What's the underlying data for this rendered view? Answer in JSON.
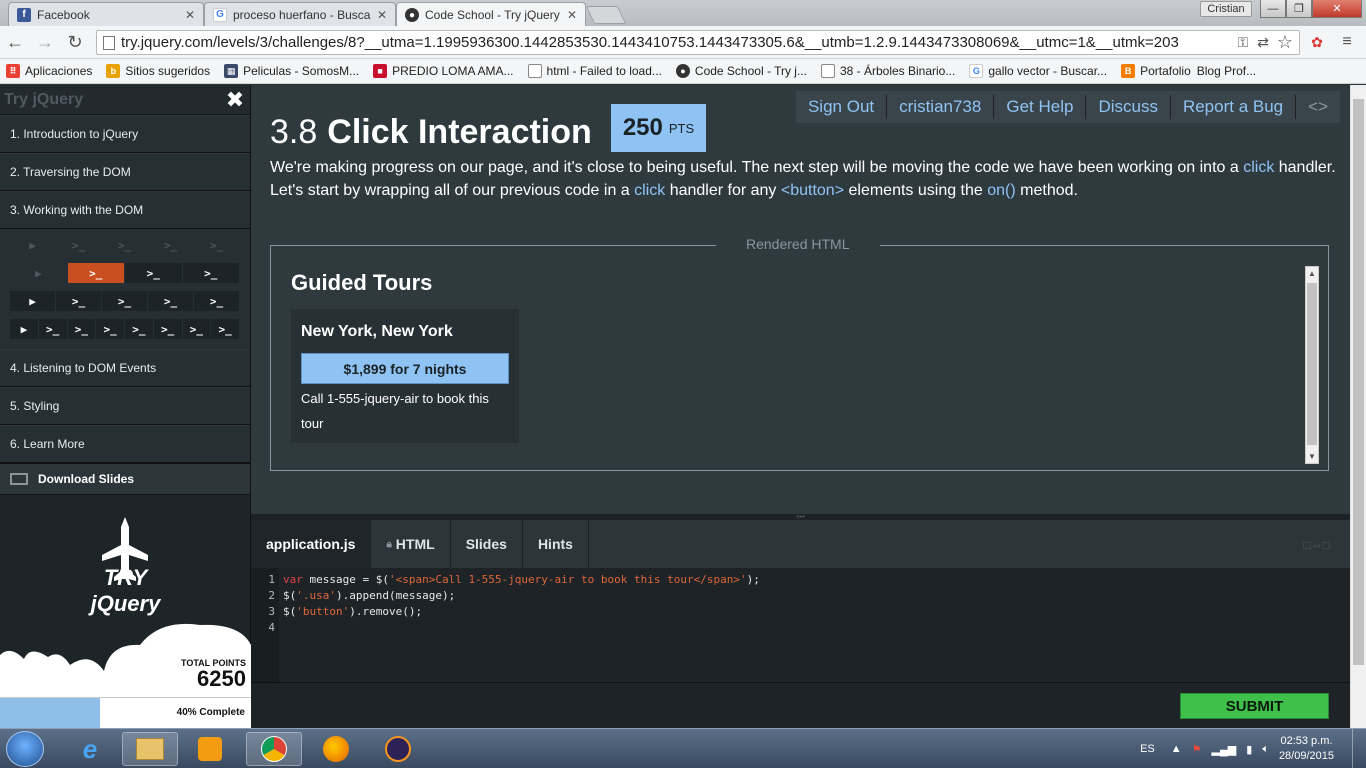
{
  "browser": {
    "tabs": [
      {
        "title": "Facebook",
        "icon": "facebook-icon",
        "color": "#3b5998"
      },
      {
        "title": "proceso huerfano - Buscar",
        "icon": "google-icon",
        "color": "#4285f4"
      },
      {
        "title": "Code School - Try jQuery",
        "icon": "codeschool-icon",
        "color": "#333333"
      }
    ],
    "user": "Cristian",
    "url": "try.jquery.com/levels/3/challenges/8?__utma=1.1995936300.1442853530.1443410753.1443473305.6&__utmb=1.2.9.1443473308069&__utmc=1&__utmk=203",
    "bookmarks": [
      {
        "label": "Aplicaciones",
        "icon": "apps-icon",
        "color": "#e94235"
      },
      {
        "label": "Sitios sugeridos",
        "icon": "bookmark-icon",
        "color": "#e8a200"
      },
      {
        "label": "Peliculas - SomosM...",
        "icon": "film-icon",
        "color": "#3a4a6a"
      },
      {
        "label": "PREDIO LOMA AMA...",
        "icon": "site-icon",
        "color": "#c8102e"
      },
      {
        "label": "html - Failed to load...",
        "icon": "page-icon",
        "color": "#888888"
      },
      {
        "label": "Code School - Try j...",
        "icon": "codeschool-icon",
        "color": "#333333"
      },
      {
        "label": "38 - Árboles Binario...",
        "icon": "page-icon",
        "color": "#888888"
      },
      {
        "label": "gallo vector - Buscar...",
        "icon": "google-icon",
        "color": "#4285f4"
      },
      {
        "label": "Portafolio",
        "icon": "blogger-icon",
        "color": "#f57d00"
      },
      {
        "label": "Blog Prof...",
        "icon": "page-icon",
        "color": "#888888"
      }
    ]
  },
  "sidebar": {
    "title": "Try jQuery",
    "levels": [
      "1. Introduction to jQuery",
      "2. Traversing the DOM",
      "3. Working with the DOM",
      "4. Listening to DOM Events",
      "5. Styling",
      "6. Learn More"
    ],
    "challenge_rows": [
      [
        "▶",
        ">_",
        ">_",
        ">_",
        ">_"
      ],
      [
        "▶",
        ">_",
        ">_",
        ">_"
      ],
      [
        "▶",
        ">_",
        ">_",
        ">_",
        ">_"
      ],
      [
        "▶",
        ">_",
        ">_",
        ">_",
        ">_",
        ">_",
        ">_",
        ">_"
      ]
    ],
    "download": "Download Slides",
    "logo_text": "TRY jQuery",
    "total_points_label": "TOTAL POINTS",
    "total_points": "6250",
    "progress_label": "40% Complete",
    "progress": 0.4
  },
  "nav": [
    "Sign Out",
    "cristian738",
    "Get Help",
    "Discuss",
    "Report a Bug",
    "<>"
  ],
  "challenge": {
    "number": "3.8",
    "name": "Click Interaction",
    "points": "250",
    "points_unit": "PTS",
    "desc_1": "We're making progress on our page, and it's close to being useful. The next step will be moving the code we have been working on into a ",
    "desc_click1": "click",
    "desc_2": " handler. Let's start by wrapping all of our previous code in a ",
    "desc_click2": "click",
    "desc_3": " handler for any ",
    "desc_button": "<button>",
    "desc_4": " elements using the ",
    "desc_on": "on()",
    "desc_5": " method."
  },
  "rendered": {
    "legend": "Rendered HTML",
    "heading": "Guided Tours",
    "tour_name": "New York, New York",
    "tour_button": "$1,899 for 7 nights",
    "tour_call": "Call 1-555-jquery-air to book this tour"
  },
  "editor": {
    "tabs": [
      "application.js",
      "HTML",
      "Slides",
      "Hints"
    ],
    "lines": [
      "1",
      "2",
      "3",
      "4"
    ],
    "submit": "SUBMIT"
  },
  "taskbar": {
    "lang": "ES",
    "time": "02:53 p.m.",
    "date": "28/09/2015"
  },
  "colors": {
    "accent": "#8fc3f4",
    "current_challenge": "#c94f20",
    "submit": "#3fc04a"
  }
}
